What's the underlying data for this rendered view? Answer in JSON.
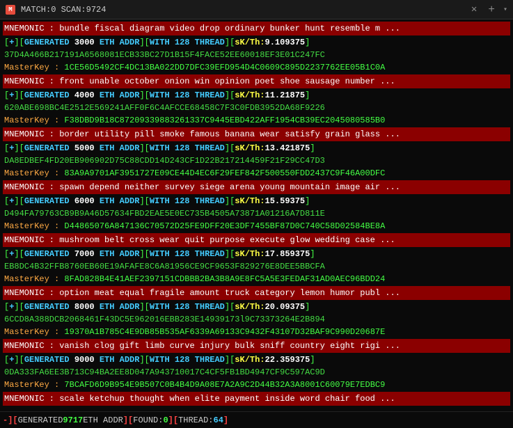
{
  "titlebar": {
    "icon": "M",
    "title": "MATCH:0 SCAN:9724",
    "close_label": "✕",
    "new_tab_label": "+",
    "dropdown_label": "▾"
  },
  "lines": [
    {
      "type": "mnemonic",
      "text": "MNEMONIC : bundle fiscal diagram video drop ordinary bunker hunt resemble m ..."
    },
    {
      "type": "generated",
      "num": "3000",
      "sk": "9.109375"
    },
    {
      "type": "hash",
      "text": "37D4A466B217191A6568081ECB33BC27D1B15F4FACE52EE60018EF3E01C247FC"
    },
    {
      "type": "masterkey",
      "text": "1CE56D5492CF4DC13BA022DD7DFC39EFD954D4C0609C895D2237762EE05B1C0A"
    },
    {
      "type": "mnemonic",
      "text": "MNEMONIC : front unable october onion win opinion poet shoe sausage number ..."
    },
    {
      "type": "generated",
      "num": "4000",
      "sk": "11.21875"
    },
    {
      "type": "hash",
      "text": "620ABE698BC4E2512E569241AFF0F6C4AFCCE68458C7F3C0FDB3952DA68F9226"
    },
    {
      "type": "masterkey",
      "text": "F38DBD9B18C87209339883261337C9445EBD422AFF1954CB39EC2045080585B0"
    },
    {
      "type": "mnemonic",
      "text": "MNEMONIC : border utility pill smoke famous banana wear satisfy grain glass ..."
    },
    {
      "type": "generated",
      "num": "5000",
      "sk": "13.421875"
    },
    {
      "type": "hash",
      "text": "DA8EDBEF4FD20EB906902D75C88CDD14D243CF1D22B217214459F21F29CC47D3"
    },
    {
      "type": "masterkey",
      "text": "83A9A9701AF3951727E09CE44D4EC6F29FEF842F500550FDD2437C9F46A00DFC"
    },
    {
      "type": "mnemonic",
      "text": "MNEMONIC : spawn depend neither survey siege arena young mountain image air ..."
    },
    {
      "type": "generated",
      "num": "6000",
      "sk": "15.59375"
    },
    {
      "type": "hash",
      "text": "D494FA79763CB9B9A46D57634FBD2EAE5E0EC735B4505A73871A01216A7D811E"
    },
    {
      "type": "masterkey",
      "text": "D44865076A847136C70572D25FE9DFF20E3DF7455BF87D0C740C58D02584BE8A"
    },
    {
      "type": "mnemonic",
      "text": "MNEMONIC : mushroom belt cross wear quit purpose execute glow wedding case ..."
    },
    {
      "type": "generated",
      "num": "7000",
      "sk": "17.859375"
    },
    {
      "type": "hash",
      "text": "EB8DC4B32FFB8760EB60E19AFAFE8C6A81956CE9CF9653F829276E8DEE5BBCFA"
    },
    {
      "type": "masterkey",
      "text": "8FAD828B4E41AEF2397151CDBBB2BA3B8A9E8FC5A5E3FEDAF31AD0AEC96BDD24"
    },
    {
      "type": "mnemonic",
      "text": "MNEMONIC : option meat equal fragile amount truck category lemon humor publ ..."
    },
    {
      "type": "generated",
      "num": "8000",
      "sk": "20.09375"
    },
    {
      "type": "hash",
      "text": "6CCD8A388DCB2068461F43DC5E962016EBB283E14939173l9C73373264E2B894"
    },
    {
      "type": "masterkey",
      "text": "19370A1B785C4E9DB85B535AF6339A69133C9432F43107D32BAF9C990D20687E"
    },
    {
      "type": "mnemonic",
      "text": "MNEMONIC : vanish clog gift limb curve injury bulk sniff country eight rigi ..."
    },
    {
      "type": "generated",
      "num": "9000",
      "sk": "22.359375"
    },
    {
      "type": "hash",
      "text": "0DA333FA6EE3B713C94BA2EE8D047A943710017C4CF5FB1BD4947CF9C597AC9D"
    },
    {
      "type": "masterkey",
      "text": "7BCAFD6D9B954E9B507C0B4B4D9A08E7A2A9C2D44B32A3A8001C60079E7EDBC9"
    },
    {
      "type": "mnemonic",
      "text": "MNEMONIC : scale ketchup thought when elite payment inside word chair food ..."
    }
  ],
  "statusbar": {
    "text": "-][ GENERATED 9717 ETH ADDR ][FOUND:0][THREAD:64"
  }
}
